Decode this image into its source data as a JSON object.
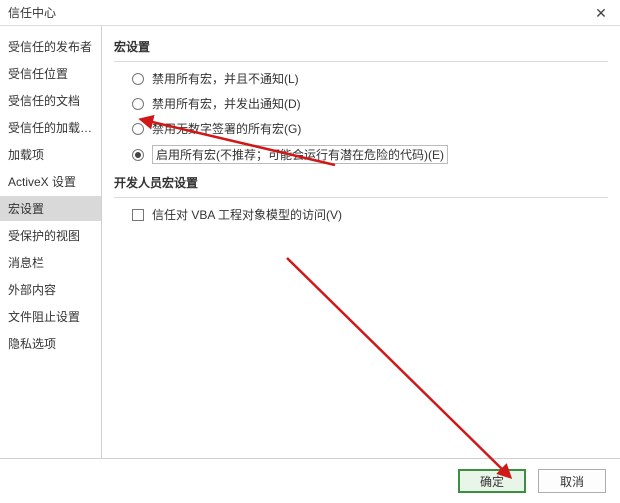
{
  "window": {
    "title": "信任中心",
    "close": "✕"
  },
  "sidebar": {
    "items": [
      "受信任的发布者",
      "受信任位置",
      "受信任的文档",
      "受信任的加载项目录",
      "加载项",
      "ActiveX 设置",
      "宏设置",
      "受保护的视图",
      "消息栏",
      "外部内容",
      "文件阻止设置",
      "隐私选项"
    ],
    "selected_index": 6
  },
  "content": {
    "group1_title": "宏设置",
    "options": [
      {
        "label": "禁用所有宏，并且不通知(L)",
        "checked": false
      },
      {
        "label": "禁用所有宏，并发出通知(D)",
        "checked": false
      },
      {
        "label": "禁用无数字签署的所有宏(G)",
        "checked": false
      },
      {
        "label": "启用所有宏(不推荐；可能会运行有潜在危险的代码)(E)",
        "checked": true,
        "boxed": true
      }
    ],
    "group2_title": "开发人员宏设置",
    "vba_trust_label": "信任对 VBA 工程对象模型的访问(V)"
  },
  "buttons": {
    "ok": "确定",
    "cancel": "取消"
  },
  "annotation": {
    "arrow_color": "#d01818"
  }
}
